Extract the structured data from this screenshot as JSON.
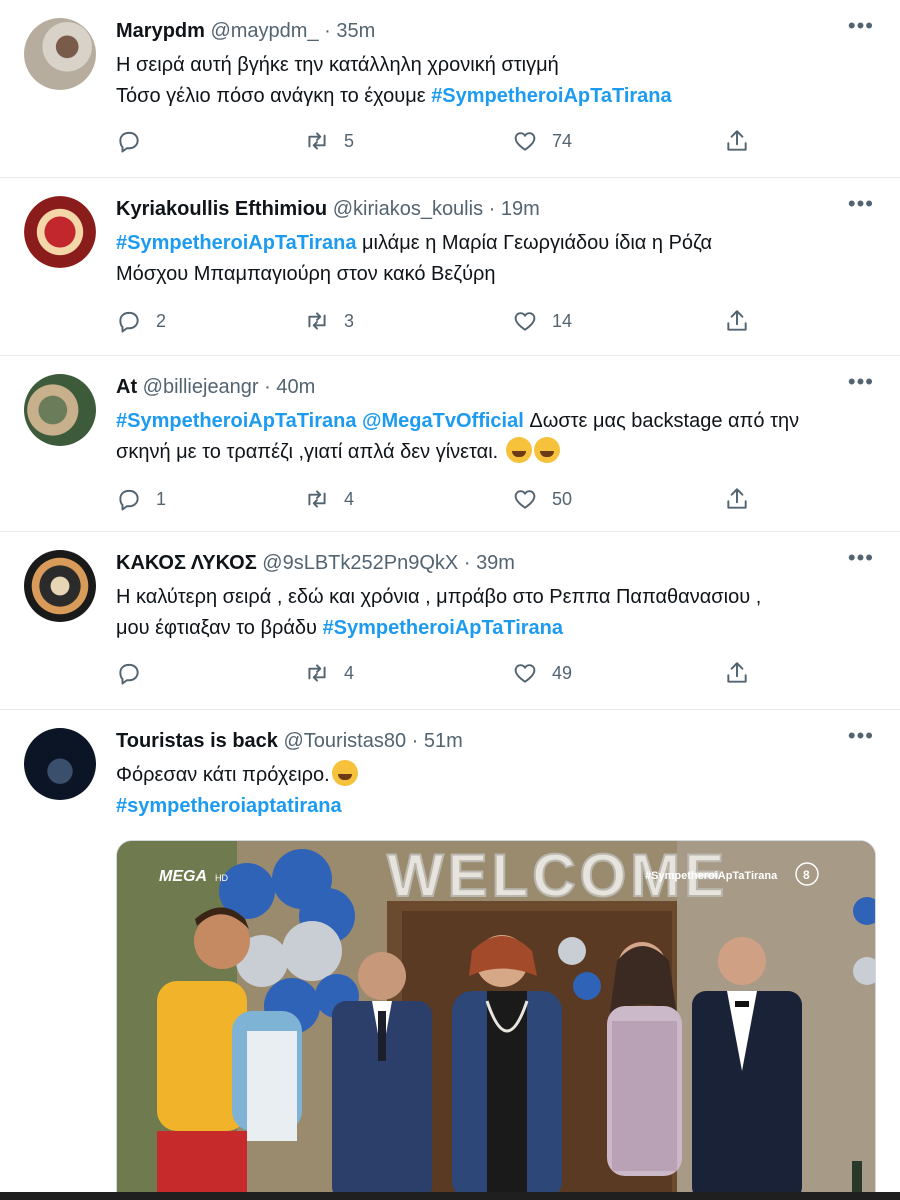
{
  "tweets": [
    {
      "name": "Marypdm",
      "handle": "@maypdm_",
      "time": "35m",
      "lines": [
        {
          "text": "Η σειρά αυτή βγήκε την κατάλληλη χρονική στιγμή",
          "hashtag": ""
        },
        {
          "text": "Τόσο γέλιο πόσο ανάγκη το έχουμε ",
          "hashtag": "#SympetheroiApTaTirana"
        }
      ],
      "replies": "",
      "retweets": "5",
      "likes": "74",
      "avatar_icon": "profile-photo"
    },
    {
      "name": "Kyriakoullis Efthimiou",
      "handle": "@kiriakos_koulis",
      "time": "19m",
      "line1_hashtag": "#SympetheroiApTaTirana",
      "line1_text": " μιλάμε η Μαρία Γεωργιάδου ίδια η Ρόζα",
      "line2_text": "Μόσχου Μπαμπαγιούρη στον κακό Βεζύρη",
      "replies": "2",
      "retweets": "3",
      "likes": "14",
      "avatar_icon": "profile-illustration"
    },
    {
      "name": "At",
      "handle": "@billiejeangr",
      "time": "40m",
      "line1_hashtag": "#SympetheroiApTaTirana",
      "line1_mention": "@MegaTvOfficial",
      "line1_text": " Δωστε μας backstage από την",
      "line2_text": "σκηνή με το τραπέζι ,γιατί απλά δεν γίνεται. ",
      "replies": "1",
      "retweets": "4",
      "likes": "50",
      "emoji": "tears-of-joy-emoji"
    },
    {
      "name": "ΚΑΚΟΣ ΛΥΚΟΣ",
      "handle": "@9sLBTk252Pn9QkX",
      "time": "39m",
      "line1_text": "Η καλύτερη σειρά , εδώ και χρόνια , μπράβο στο Ρεππα Παπαθανασιου ,",
      "line2_text": "μου έφτιαξαν το βράδυ  ",
      "line2_hashtag": "#SympetheroiApTaTirana",
      "replies": "",
      "retweets": "4",
      "likes": "49"
    },
    {
      "name": "Touristas is back",
      "handle": "@Touristas80",
      "time": "51m",
      "line1_text": "Φόρεσαν κάτι πρόχειρο.",
      "line2_hashtag": "#sympetheroiaptatirana",
      "emoji": "rolling-laughing-emoji",
      "media": {
        "balloon_text": "WELCOME",
        "channel_logo": "MEGA",
        "channel_sub": "HD",
        "overlay_hashtag": "#SympetheroiApTaTirana",
        "rating": "8"
      }
    }
  ],
  "ui": {
    "separator": "·",
    "more_glyph": "•••"
  },
  "colors": {
    "link": "#1d9bf0",
    "muted": "#536471",
    "text": "#0f1419",
    "divider": "#e6ecf0"
  }
}
